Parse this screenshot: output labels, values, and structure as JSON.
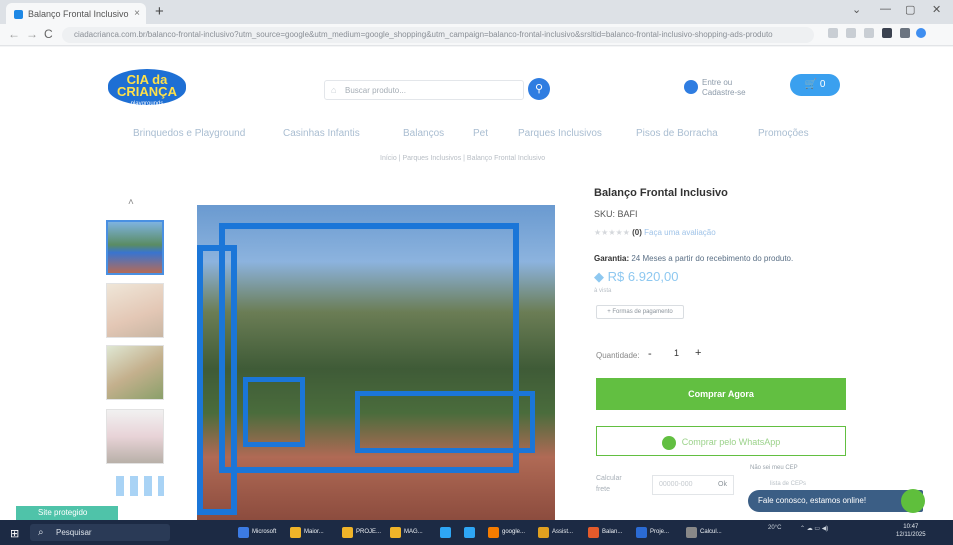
{
  "browser": {
    "tab_title": "Balanço Frontal Inclusivo",
    "tab_close": "×",
    "new_tab": "+",
    "win_min": "—",
    "win_max": "▢",
    "win_close": "✕",
    "win_chevron": "⌄",
    "back": "←",
    "forward": "→",
    "reload": "C",
    "url": "ciadacrianca.com.br/balanco-frontal-inclusivo?utm_source=google&utm_medium=google_shopping&utm_campaign=balanco-frontal-inclusivo&srsltid=balanco-frontal-inclusivo-shopping-ads-produto"
  },
  "site": {
    "logo_line1": "CIA da",
    "logo_line2": "CRIANÇA",
    "logo_sub": "playgrounds",
    "search_placeholder": "Buscar produto...",
    "search_icon": "search-icon",
    "login_line1": "Entre ou",
    "login_line2": "Cadastre-se",
    "cart_label": "0",
    "menu": [
      "Brinquedos e Playground",
      "Casinhas Infantis",
      "Balanços",
      "Pet",
      "Parques Inclusivos",
      "Pisos de Borracha",
      "Promoções"
    ],
    "breadcrumb": "Início  |  Parques Inclusivos  |  Balanço Frontal Inclusivo"
  },
  "product": {
    "thumbs_up_arrow": "˄",
    "title": "Balanço Frontal Inclusivo",
    "sku": "SKU: BAFI",
    "stars": "★★★★★",
    "rating_count": "(0)",
    "rating_link": "Faça uma avaliação",
    "warranty_label": "Garantia:",
    "warranty_text": "24 Meses a partir do recebimento do produto.",
    "price_icon": "◆",
    "price": "R$ 6.920,00",
    "price_note": "à vista",
    "calc_button": "+ Formas de pagamento",
    "qty_label": "Quantidade:",
    "qty_minus": "-",
    "qty_value": "1",
    "qty_plus": "+",
    "buy_button": "Comprar Agora",
    "whatsapp_button": "Comprar pelo WhatsApp",
    "freight_line1": "Calcular",
    "freight_line2": "frete",
    "cep_placeholder": "00000-000",
    "cep_button": "Ok",
    "not_know_cep": "Não sei meu CEP",
    "list_cep": "lista de CEPs"
  },
  "chat": {
    "text": "Fale conosco, estamos online!",
    "online_badge": "Site protegido"
  },
  "taskbar": {
    "start_icon": "⊞",
    "search_icon": "⌕",
    "search_label": "Pesquisar",
    "apps": [
      {
        "label": "Microsoft",
        "color": "#3c7be3"
      },
      {
        "label": "Maior...",
        "color": "#f0b429"
      },
      {
        "label": "PROJE...",
        "color": "#f0b429"
      },
      {
        "label": "MAG...",
        "color": "#f0b429"
      },
      {
        "label": "",
        "color": "#2ea6f5"
      },
      {
        "label": "",
        "color": "#2ea6f5"
      },
      {
        "label": "google...",
        "color": "#f57c00"
      },
      {
        "label": "Assist...",
        "color": "#e0a020"
      },
      {
        "label": "Balan...",
        "color": "#e55b2b"
      },
      {
        "label": "Proje...",
        "color": "#2b6bd4"
      },
      {
        "label": "Calcul...",
        "color": "#888888"
      }
    ],
    "weather": "20°C",
    "tray_icons": "⌃  ☁  ▭  ◀)",
    "time": "10:47",
    "date": "12/11/2025"
  }
}
